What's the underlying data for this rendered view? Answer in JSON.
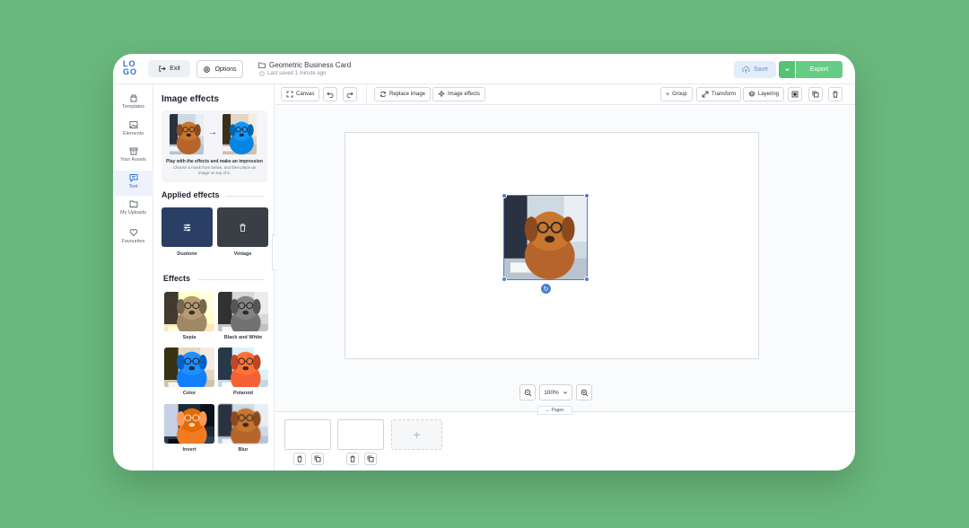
{
  "app": {
    "logo_top": "LO",
    "logo_bottom": "GO"
  },
  "header": {
    "exit_label": "Exit",
    "options_label": "Options",
    "doc_title": "Geometric Business Card",
    "last_saved": "Last saved 1 minute ago",
    "save_label": "Save",
    "export_label": "Export"
  },
  "rail": {
    "items": [
      {
        "label": "Templates",
        "icon": "template-icon"
      },
      {
        "label": "Elements",
        "icon": "image-icon"
      },
      {
        "label": "Your Assets",
        "icon": "box-icon"
      },
      {
        "label": "Text",
        "icon": "chat-icon"
      },
      {
        "label": "My Uploads",
        "icon": "folder-icon"
      },
      {
        "label": "Favourites",
        "icon": "heart-icon"
      }
    ],
    "active": "Text"
  },
  "panel": {
    "title": "Image effects",
    "promo_title": "Play with the effects and make an impression",
    "promo_text": "Choose a mask from below, and then place an image on top of it.",
    "applied_heading": "Applied effects",
    "applied": [
      {
        "label": "Duotone",
        "icon": "sliders-icon"
      },
      {
        "label": "Vintage",
        "icon": "trash-icon"
      }
    ],
    "effects_heading": "Effects",
    "effects": [
      {
        "label": "Sepia"
      },
      {
        "label": "Black and White"
      },
      {
        "label": "Color"
      },
      {
        "label": "Polaroid"
      },
      {
        "label": "Invert"
      },
      {
        "label": "Blur"
      }
    ]
  },
  "toolbar": {
    "canvas_label": "Canvas",
    "replace_label": "Replace image",
    "effects_label": "Image effects",
    "group_label": "Group",
    "transform_label": "Transform",
    "layering_label": "Layering"
  },
  "zoom": {
    "level": "100%"
  },
  "pages": {
    "tab_label": "Pages",
    "add_symbol": "+"
  },
  "colors": {
    "background": "#69b87d",
    "accent_blue": "#4a7fd4",
    "export_green": "#67cc85",
    "save_bg": "#e3edfa"
  }
}
